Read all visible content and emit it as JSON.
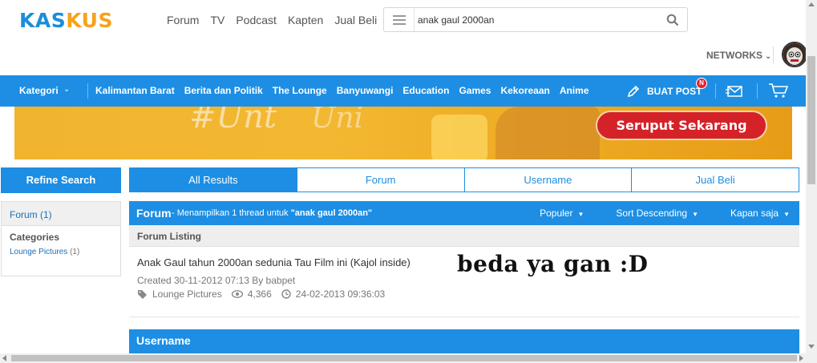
{
  "header": {
    "logo_part1": "KAS",
    "logo_part2": "KUS",
    "nav": [
      "Forum",
      "TV",
      "Podcast",
      "Kapten",
      "Jual Beli"
    ],
    "search_value": "anak gaul 2000an",
    "networks_label": "NETWORKS"
  },
  "bluenav": {
    "kategori_label": "Kategori",
    "categories": [
      "Kalimantan Barat",
      "Berita dan Politik",
      "The Lounge",
      "Banyuwangi",
      "Education",
      "Games",
      "Kekoreaan",
      "Anime"
    ],
    "buat_post_label": "BUAT POST",
    "badge": "N"
  },
  "banner": {
    "cta_label": "Seruput Sekarang",
    "deco_text1": "#Unt",
    "deco_text2": "Uni"
  },
  "sidebar": {
    "refine_label": "Refine Search",
    "forum_filter": "Forum (1)",
    "categories_heading": "Categories",
    "category_item": "Lounge Pictures",
    "category_count": "(1)"
  },
  "tabs": [
    "All Results",
    "Forum",
    "Username",
    "Jual Beli"
  ],
  "forum_section": {
    "title": "Forum",
    "subtitle_prefix": " - Menampilkan 1 thread untuk ",
    "subtitle_query": "\"anak gaul 2000an\"",
    "sort_popular": "Populer",
    "sort_order": "Sort Descending",
    "sort_time": "Kapan saja",
    "listing_label": "Forum Listing"
  },
  "thread": {
    "title": "Anak Gaul tahun 2000an sedunia Tau Film ini (Kajol inside)",
    "created": "Created 30-11-2012 07:13 By babpet",
    "category": "Lounge Pictures",
    "views": "4,366",
    "last_updated": "24-02-2013 09:36:03",
    "overlay_text": "beda ya gan :D"
  },
  "username_section": {
    "title": "Username"
  },
  "colors": {
    "primary_blue": "#1d8ee3",
    "logo_blue": "#1b8ed9",
    "logo_orange": "#f7a21b",
    "cta_red": "#d42228"
  }
}
